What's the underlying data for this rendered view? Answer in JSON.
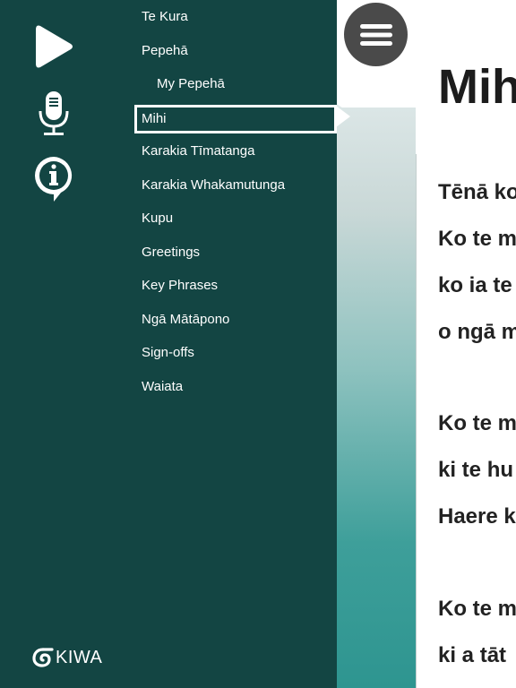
{
  "sidebar": {
    "icons": [
      {
        "name": "play-icon"
      },
      {
        "name": "microphone-icon"
      },
      {
        "name": "info-icon"
      }
    ],
    "menu": [
      {
        "label": "Te Kura",
        "sub": false,
        "active": false
      },
      {
        "label": "Pepehā",
        "sub": false,
        "active": false
      },
      {
        "label": "My Pepehā",
        "sub": true,
        "active": false
      },
      {
        "label": "Mihi",
        "sub": false,
        "active": true
      },
      {
        "label": "Karakia Tīmatanga",
        "sub": false,
        "active": false
      },
      {
        "label": "Karakia Whakamutunga",
        "sub": false,
        "active": false
      },
      {
        "label": "Kupu",
        "sub": false,
        "active": false
      },
      {
        "label": "Greetings",
        "sub": false,
        "active": false
      },
      {
        "label": "Key Phrases",
        "sub": false,
        "active": false
      },
      {
        "label": "Ngā Mātāpono",
        "sub": false,
        "active": false
      },
      {
        "label": "Sign-offs",
        "sub": false,
        "active": false
      },
      {
        "label": "Waiata",
        "sub": false,
        "active": false
      }
    ],
    "logo_text": "KIWA"
  },
  "content": {
    "title": "Mihi",
    "lines": [
      "Tēnā ko",
      "Ko te m",
      "ko ia te",
      "o ngā m",
      "Ko te m",
      "ki te hu",
      "Haere k",
      "Ko te m",
      "ki a tāt"
    ]
  },
  "colors": {
    "drawer": "#134543",
    "fab": "#4a4a4a",
    "text": "#222222"
  }
}
